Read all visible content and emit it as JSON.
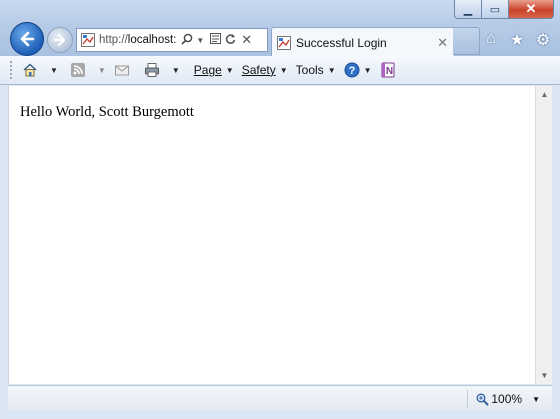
{
  "window": {
    "caption_min": "▁",
    "caption_max": "▭",
    "caption_close": "✕"
  },
  "address_bar": {
    "url_prefix": "http://",
    "url_host": "localhost:",
    "search_icon": "search-icon",
    "refresh_icon": "refresh-icon",
    "stop_icon": "stop-icon"
  },
  "tab": {
    "title": "Successful Login",
    "close": "✕"
  },
  "command_bar": {
    "page_label": "Page",
    "safety_label": "Safety",
    "tools_label": "Tools"
  },
  "page": {
    "body_text": "Hello World, Scott Burgemott"
  },
  "status_bar": {
    "zoom": "100%"
  }
}
